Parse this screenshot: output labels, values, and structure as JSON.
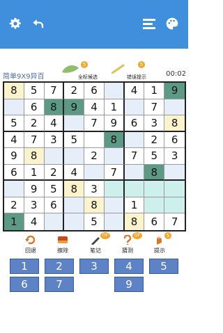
{
  "header": {
    "settings_icon": "gear-icon",
    "back_icon": "undo-arrow-icon",
    "menu_icon": "list-icon",
    "theme_icon": "palette-icon"
  },
  "status": {
    "level": "简单9X9异百",
    "candidates": {
      "label": "全标候选",
      "count": "5"
    },
    "error_hint": {
      "label": "错误提示",
      "count": "5"
    },
    "timer": "00:02"
  },
  "board": {
    "rows": [
      [
        "8",
        "5",
        "7",
        "2",
        "6",
        "",
        "4",
        "1",
        "9"
      ],
      [
        "",
        "6",
        "8",
        "9",
        "4",
        "1",
        "",
        "7",
        ""
      ],
      [
        "5",
        "2",
        "4",
        "",
        "7",
        "9",
        "6",
        "3",
        "8"
      ],
      [
        "4",
        "7",
        "3",
        "5",
        "",
        "8",
        "",
        "2",
        "6"
      ],
      [
        "9",
        "8",
        "",
        "",
        "2",
        "",
        "7",
        "5",
        "3"
      ],
      [
        "6",
        "1",
        "2",
        "4",
        "",
        "7",
        "",
        "8",
        ""
      ],
      [
        "",
        "9",
        "5",
        "8",
        "3",
        "",
        "",
        "",
        ""
      ],
      [
        "2",
        "3",
        "6",
        "",
        "8",
        "",
        "1",
        "",
        ""
      ],
      [
        "1",
        "4",
        "",
        "",
        "5",
        "",
        "8",
        "6",
        "7"
      ]
    ],
    "fills": [
      [
        "#fbf3cc",
        "#ffffff",
        "#ffffff",
        "#ffffff",
        "#ffffff",
        "#e6eefa",
        "#ffffff",
        "#ffffff",
        "#5d9a85"
      ],
      [
        "#e6eefa",
        "#ffffff",
        "#5d9a85",
        "#5d9a85",
        "#ffffff",
        "#ffffff",
        "#e6eefa",
        "#ffffff",
        "#e6eefa"
      ],
      [
        "#ffffff",
        "#ffffff",
        "#ffffff",
        "#e6eefa",
        "#ffffff",
        "#ffffff",
        "#ffffff",
        "#ffffff",
        "#fbf3cc"
      ],
      [
        "#ffffff",
        "#ffffff",
        "#ffffff",
        "#ffffff",
        "#ffffff",
        "#5d9a85",
        "#e6eefa",
        "#ffffff",
        "#ffffff"
      ],
      [
        "#ffffff",
        "#fbf3cc",
        "#e6eefa",
        "#e6eefa",
        "#ffffff",
        "#e6eefa",
        "#ffffff",
        "#ffffff",
        "#ffffff"
      ],
      [
        "#ffffff",
        "#ffffff",
        "#ffffff",
        "#ffffff",
        "#e6eefa",
        "#ffffff",
        "#e6eefa",
        "#5d9a85",
        "#e6eefa"
      ],
      [
        "#e6eefa",
        "#ffffff",
        "#ffffff",
        "#fbf3cc",
        "#ffffff",
        "#cdf0ec",
        "#cdf0ec",
        "#cdf0ec",
        "#cdf0ec"
      ],
      [
        "#ffffff",
        "#ffffff",
        "#ffffff",
        "#e6eefa",
        "#fbf3cc",
        "#e6eefa",
        "#ffffff",
        "#cdf0ec",
        "#cdf0ec"
      ],
      [
        "#5d9a85",
        "#ffffff",
        "#e6eefa",
        "#e6eefa",
        "#ffffff",
        "#e6eefa",
        "#fbf3cc",
        "#ffffff",
        "#ffffff"
      ]
    ]
  },
  "actions": [
    {
      "label": "回退",
      "icon": "undo-icon"
    },
    {
      "label": "擦除",
      "icon": "eraser-icon"
    },
    {
      "label": "笔记",
      "icon": "pencil-icon",
      "badge": "OF"
    },
    {
      "label": "猜测",
      "icon": "question-icon",
      "badge": "OF"
    },
    {
      "label": "提示",
      "icon": "hand-icon",
      "badge": "5"
    }
  ],
  "numpad": {
    "row1": [
      "1",
      "2",
      "3",
      "4",
      "5"
    ],
    "row2": [
      "6",
      "7",
      "9"
    ]
  },
  "colors": {
    "header": "#3f8fdc",
    "key": "#5d82c6",
    "given_fill": "#5d9a85",
    "highlight": "#fbf3cc"
  }
}
